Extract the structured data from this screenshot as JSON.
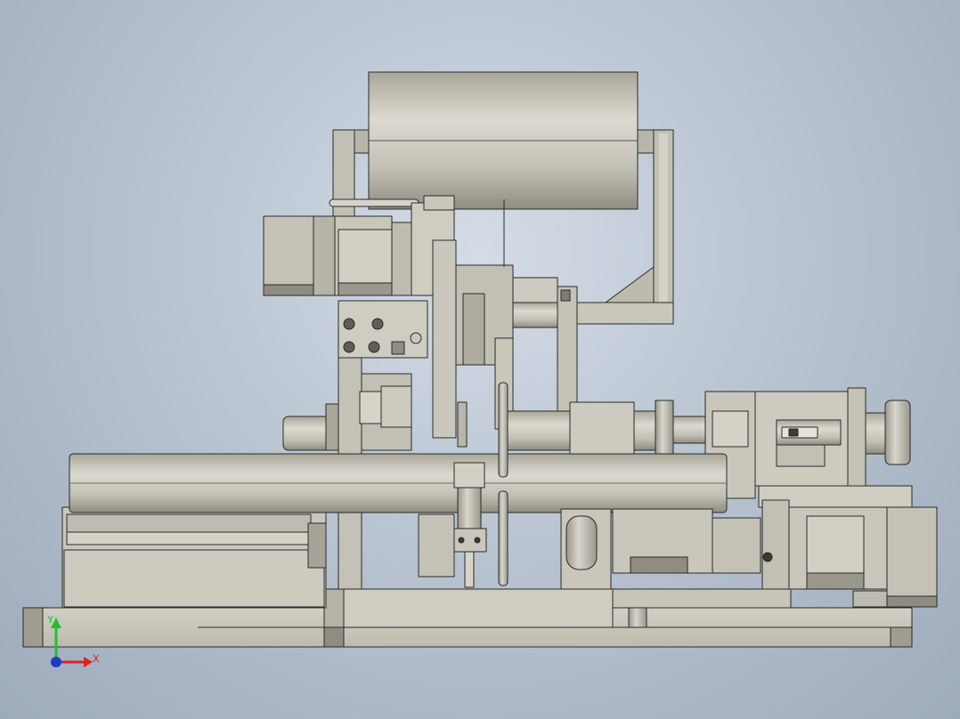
{
  "triad": {
    "x_label": "X",
    "y_label": "Y",
    "x_color": "#e02020",
    "y_color": "#20c030",
    "origin_color": "#1a3cc8"
  },
  "colors": {
    "background_center": "#d4dce6",
    "background_edge": "#9eabbb",
    "part_fill": "#c9c7bb",
    "part_shade": "#a9a799",
    "part_dark": "#7f7d72",
    "edge": "#2a2a28"
  }
}
